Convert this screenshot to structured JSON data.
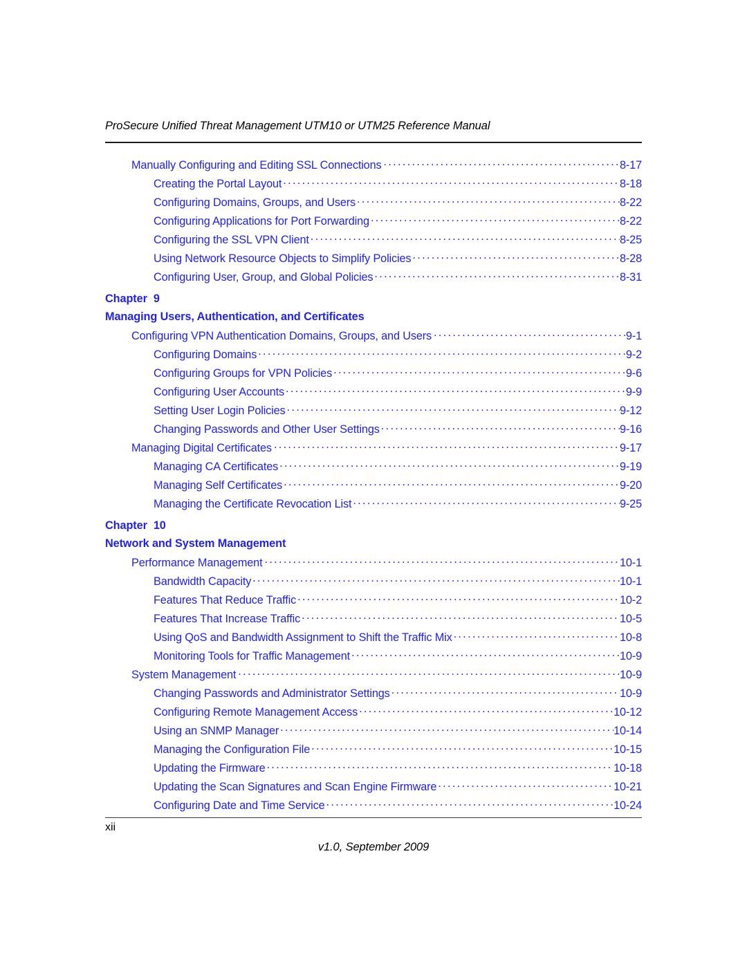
{
  "header": {
    "running_title": "ProSecure Unified Threat Management UTM10 or UTM25 Reference Manual"
  },
  "colors": {
    "link_blue": "#2323e6",
    "text_black": "#000000",
    "rule": "#1a1a1a"
  },
  "toc": {
    "entries": [
      {
        "level": 1,
        "title": "Manually Configuring and Editing SSL Connections",
        "page": "8-17"
      },
      {
        "level": 2,
        "title": "Creating the Portal Layout",
        "page": "8-18"
      },
      {
        "level": 2,
        "title": "Configuring Domains, Groups, and Users",
        "page": "8-22"
      },
      {
        "level": 2,
        "title": "Configuring Applications for Port Forwarding",
        "page": "8-22"
      },
      {
        "level": 2,
        "title": "Configuring the SSL VPN Client",
        "page": "8-25"
      },
      {
        "level": 2,
        "title": "Using Network Resource Objects to Simplify Policies",
        "page": "8-28"
      },
      {
        "level": 2,
        "title": "Configuring User, Group, and Global Policies",
        "page": "8-31"
      }
    ]
  },
  "chapters": [
    {
      "chapter_label": "Chapter",
      "chapter_number": "9",
      "chapter_title": "Managing Users, Authentication, and Certificates",
      "entries": [
        {
          "level": 1,
          "title": "Configuring VPN Authentication Domains, Groups, and Users",
          "page": "9-1"
        },
        {
          "level": 2,
          "title": "Configuring Domains",
          "page": "9-2"
        },
        {
          "level": 2,
          "title": "Configuring Groups for VPN Policies",
          "page": "9-6"
        },
        {
          "level": 2,
          "title": "Configuring User Accounts",
          "page": "9-9"
        },
        {
          "level": 2,
          "title": "Setting User Login Policies",
          "page": "9-12"
        },
        {
          "level": 2,
          "title": "Changing Passwords and Other User Settings",
          "page": "9-16"
        },
        {
          "level": 1,
          "title": "Managing Digital Certificates",
          "page": "9-17"
        },
        {
          "level": 2,
          "title": "Managing CA Certificates",
          "page": "9-19"
        },
        {
          "level": 2,
          "title": "Managing Self Certificates",
          "page": "9-20"
        },
        {
          "level": 2,
          "title": "Managing the Certificate Revocation List",
          "page": "9-25"
        }
      ]
    },
    {
      "chapter_label": "Chapter",
      "chapter_number": "10",
      "chapter_title": "Network and System Management",
      "entries": [
        {
          "level": 1,
          "title": "Performance Management",
          "page": "10-1"
        },
        {
          "level": 2,
          "title": "Bandwidth Capacity",
          "page": "10-1"
        },
        {
          "level": 2,
          "title": "Features That Reduce Traffic",
          "page": "10-2"
        },
        {
          "level": 2,
          "title": "Features That Increase Traffic",
          "page": "10-5"
        },
        {
          "level": 2,
          "title": "Using QoS and Bandwidth Assignment to Shift the Traffic Mix",
          "page": "10-8"
        },
        {
          "level": 2,
          "title": "Monitoring Tools for Traffic Management",
          "page": "10-9"
        },
        {
          "level": 1,
          "title": "System Management",
          "page": "10-9"
        },
        {
          "level": 2,
          "title": "Changing Passwords and Administrator Settings",
          "page": "10-9"
        },
        {
          "level": 2,
          "title": "Configuring Remote Management Access",
          "page": "10-12"
        },
        {
          "level": 2,
          "title": "Using an SNMP Manager",
          "page": "10-14"
        },
        {
          "level": 2,
          "title": "Managing the Configuration File",
          "page": "10-15"
        },
        {
          "level": 2,
          "title": "Updating the Firmware",
          "page": "10-18"
        },
        {
          "level": 2,
          "title": "Updating the Scan Signatures and Scan Engine Firmware",
          "page": "10-21"
        },
        {
          "level": 2,
          "title": "Configuring Date and Time Service",
          "page": "10-24"
        }
      ]
    }
  ],
  "footer": {
    "folio": "xii",
    "version": "v1.0, September 2009"
  }
}
